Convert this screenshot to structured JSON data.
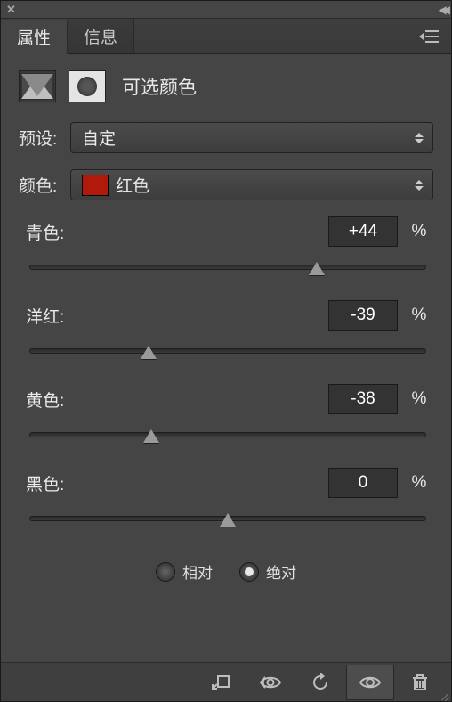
{
  "tabs": {
    "properties": "属性",
    "info": "信息"
  },
  "adjustment_title": "可选颜色",
  "preset": {
    "label": "预设:",
    "value": "自定"
  },
  "colors": {
    "label": "颜色:",
    "value": "红色",
    "swatch": "#b11a0a"
  },
  "channels": {
    "cyan": {
      "label": "青色:",
      "value": "+44",
      "pct": "%",
      "pos": 72
    },
    "magenta": {
      "label": "洋红:",
      "value": "-39",
      "pct": "%",
      "pos": 30.5
    },
    "yellow": {
      "label": "黄色:",
      "value": "-38",
      "pct": "%",
      "pos": 31
    },
    "black": {
      "label": "黑色:",
      "value": "0",
      "pct": "%",
      "pos": 50
    }
  },
  "method": {
    "relative": "相对",
    "absolute": "绝对",
    "selected": "absolute"
  }
}
